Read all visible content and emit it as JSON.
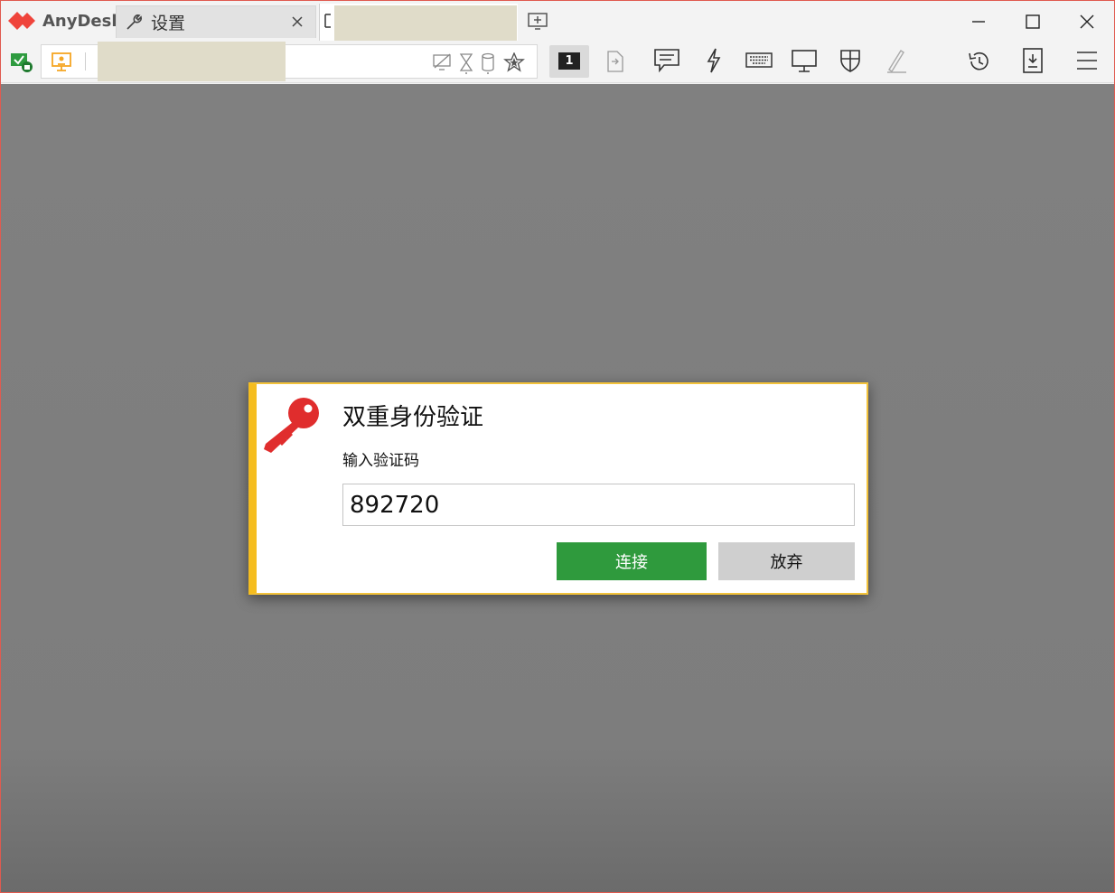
{
  "app": {
    "name": "AnyDesk"
  },
  "tabs": [
    {
      "label": "设置"
    },
    {
      "label": ""
    }
  ],
  "dialog": {
    "title": "双重身份验证",
    "prompt": "输入验证码",
    "code_value": "892720",
    "connect_label": "连接",
    "cancel_label": "放弃"
  },
  "toolbar": {
    "monitor_number": "1"
  },
  "colors": {
    "brand": "#ef443b",
    "dialog_accent": "#f5bd1f",
    "connect_button": "#2f9a3d",
    "cancel_button": "#cfcfcf"
  }
}
